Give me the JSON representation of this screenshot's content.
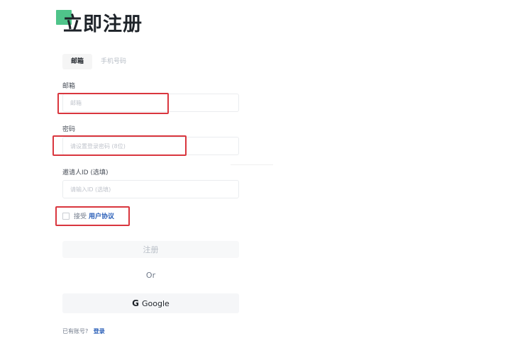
{
  "title": "立即注册",
  "tabs": [
    {
      "label": "邮箱",
      "active": true
    },
    {
      "label": "手机号码",
      "active": false
    }
  ],
  "email": {
    "label": "邮箱",
    "placeholder": "邮箱"
  },
  "password": {
    "label": "密码",
    "placeholder": "请设置登录密码 (8位)"
  },
  "referral": {
    "label": "邀请人ID (选填)",
    "placeholder": "请输入ID (选填)"
  },
  "agreement": {
    "prefix": "接受",
    "link": "用户协议"
  },
  "register_button": "注册",
  "or_text": "Or",
  "google": {
    "icon": "G",
    "label": "Google"
  },
  "login": {
    "prompt": "已有账号?",
    "link": "登录"
  },
  "colors": {
    "accent": "#4fc48a",
    "link": "#2a5fb8",
    "highlight": "#d9363e"
  }
}
